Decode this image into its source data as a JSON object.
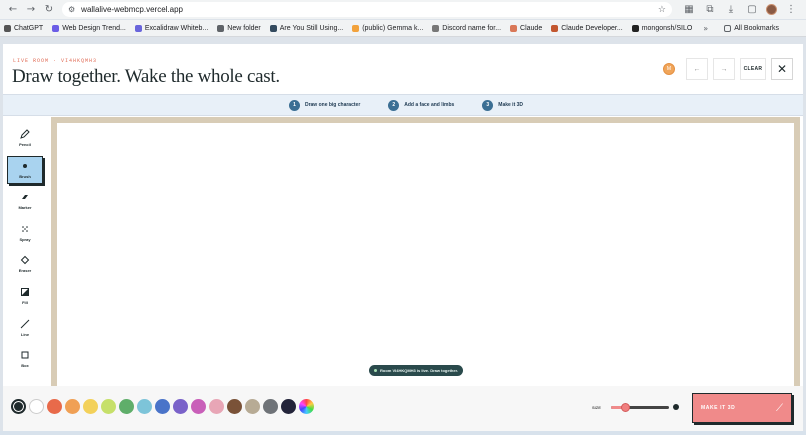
{
  "browser": {
    "url": "wallalive-webmcp.vercel.app",
    "bookmarks": [
      {
        "label": "ChatGPT",
        "color": "#555555"
      },
      {
        "label": "Web Design Trend...",
        "color": "#6b5de6"
      },
      {
        "label": "Excalidraw Whiteb...",
        "color": "#6965db"
      },
      {
        "label": "New folder",
        "color": "#5f6368"
      },
      {
        "label": "Are You Still Using...",
        "color": "#334a5e"
      },
      {
        "label": "(public) Gemma k...",
        "color": "#f2a23c"
      },
      {
        "label": "Discord name for...",
        "color": "#777777"
      },
      {
        "label": "Claude",
        "color": "#d97757"
      },
      {
        "label": "Claude Developer...",
        "color": "#c2562f"
      },
      {
        "label": "mongonsh/SILO",
        "color": "#222222"
      }
    ],
    "more": "»",
    "all_bookmarks": "All Bookmarks"
  },
  "header": {
    "live_label": "LIVE ROOM · VI4HKQMH3",
    "title": "Draw together. Wake the whole cast.",
    "avatar_initial": "M",
    "undo_label": "←",
    "redo_label": "→",
    "clear_label": "CLEAR",
    "close_label": "✕"
  },
  "steps": [
    {
      "num": "1",
      "label": "Draw one big character"
    },
    {
      "num": "2",
      "label": "Add a face and limbs"
    },
    {
      "num": "3",
      "label": "Make it 3D"
    }
  ],
  "tools": [
    {
      "label": "Pencil",
      "icon": "pencil-icon",
      "active": false
    },
    {
      "label": "Brush",
      "icon": "brush-icon",
      "active": true
    },
    {
      "label": "Marker",
      "icon": "marker-icon",
      "active": false
    },
    {
      "label": "Spray",
      "icon": "spray-icon",
      "active": false
    },
    {
      "label": "Eraser",
      "icon": "eraser-icon",
      "active": false
    },
    {
      "label": "Fill",
      "icon": "fill-icon",
      "active": false
    },
    {
      "label": "Line",
      "icon": "line-icon",
      "active": false
    },
    {
      "label": "Box",
      "icon": "box-icon",
      "active": false
    }
  ],
  "toast": "Room VI4HKQMH3 is live. Draw together.",
  "palette": [
    "#1f2a2c",
    "#ffffff",
    "#e86a4a",
    "#f0a055",
    "#f3d15a",
    "#c6e06a",
    "#5fae6a",
    "#7dc4d9",
    "#4a74c9",
    "#7a62c9",
    "#c95fb9",
    "#e8a6b6",
    "#7a5238",
    "#b7ab95",
    "#6f7378",
    "#23243a"
  ],
  "size": {
    "label": "SIZE",
    "value_fraction": 0.25
  },
  "make3d_label": "MAKE IT 3D"
}
